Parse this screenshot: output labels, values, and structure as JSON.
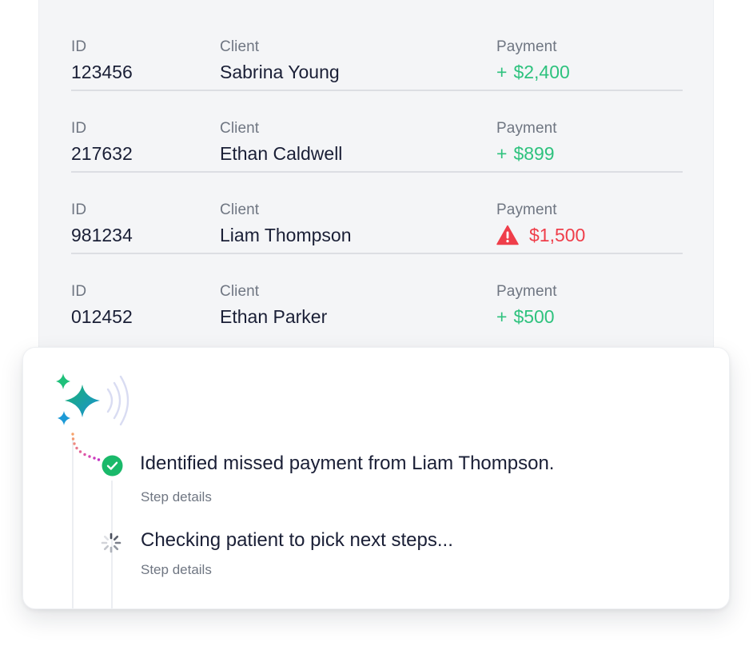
{
  "payments_table": {
    "columns": {
      "id": "ID",
      "client": "Client",
      "payment": "Payment"
    },
    "rows": [
      {
        "id": "123456",
        "client": "Sabrina Young",
        "sign": "+",
        "amount": "$2,400",
        "status": "received"
      },
      {
        "id": "217632",
        "client": "Ethan Caldwell",
        "sign": "+",
        "amount": "$899",
        "status": "received"
      },
      {
        "id": "981234",
        "client": "Liam Thompson",
        "sign": "",
        "amount": "$1,500",
        "status": "missed",
        "status_icon": "warning-triangle-icon"
      },
      {
        "id": "012452",
        "client": "Ethan Parker",
        "sign": "+",
        "amount": "$500",
        "status": "received"
      }
    ]
  },
  "agent_activity": {
    "icon": "ai-sparkle-icon",
    "steps": [
      {
        "title": "Identified missed payment from Liam Thompson.",
        "detail": "Step details",
        "state": "completed",
        "icon": "check-circle-icon"
      },
      {
        "title": "Checking patient to pick next steps...",
        "detail": "Step details",
        "state": "in-progress",
        "icon": "spinner-icon"
      }
    ]
  },
  "colors": {
    "positive": "#2ec27e",
    "negative": "#ef3e4a",
    "check": "#1ab96a",
    "sparkle_teal": "#1d9ad6",
    "sparkle_green": "#1fc07a",
    "text_primary": "#1a1f36",
    "text_secondary": "#6f7682"
  }
}
